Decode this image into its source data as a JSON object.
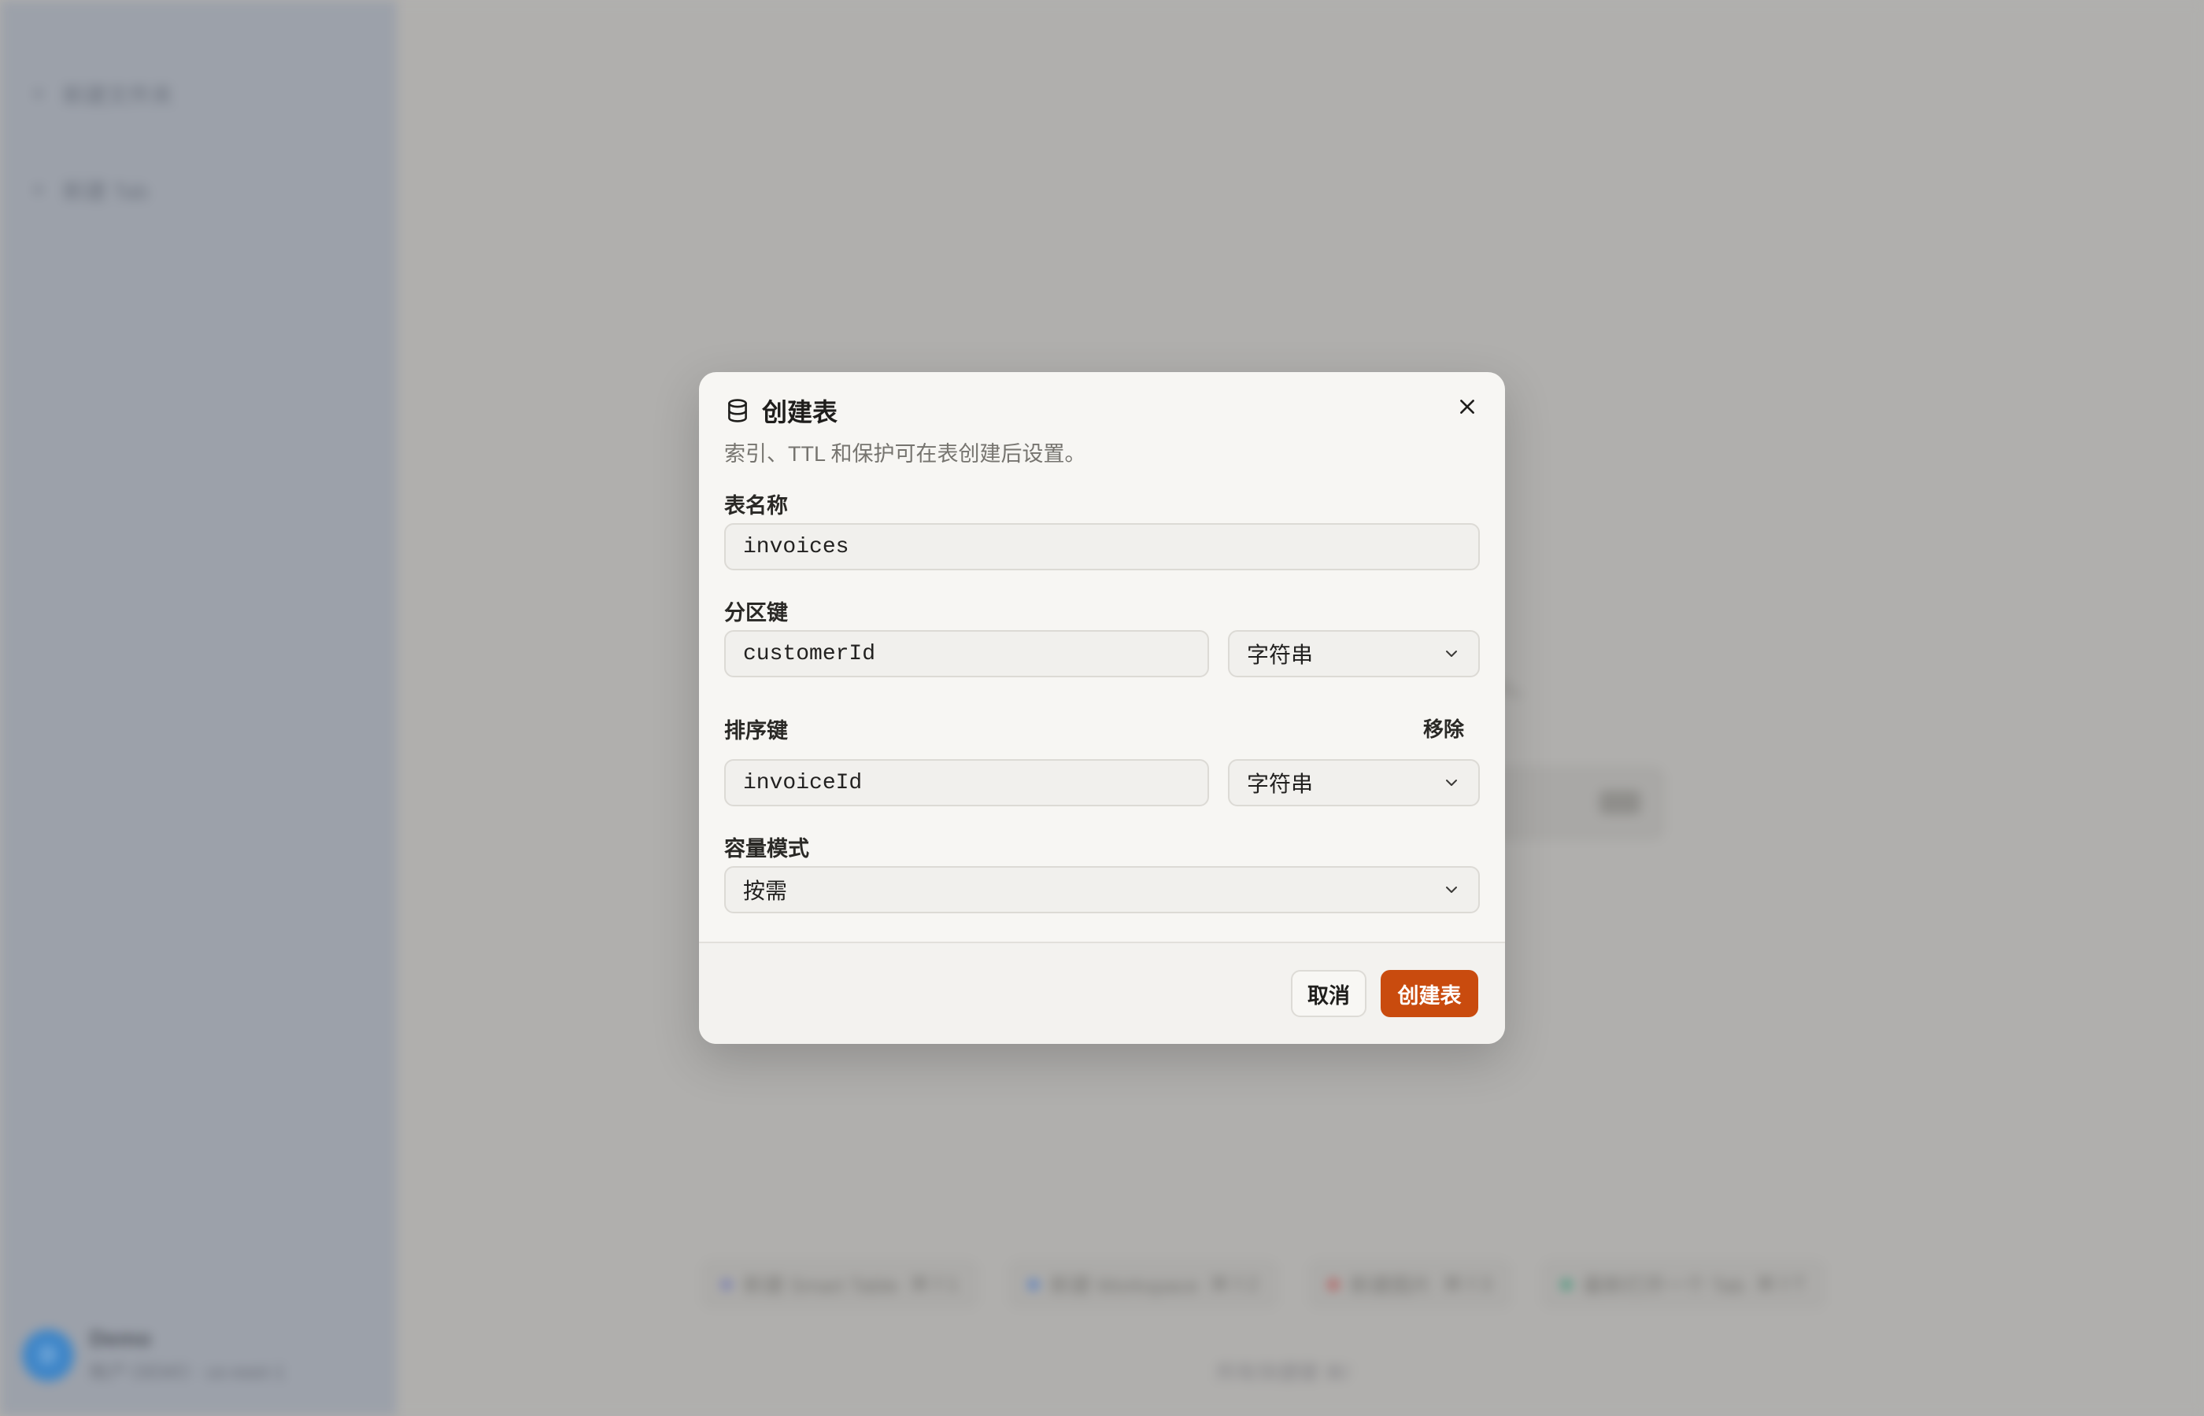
{
  "background": {
    "sidebar": {
      "items": [
        {
          "label": "新建文件夹"
        },
        {
          "label": "新建 Tab"
        }
      ],
      "user": {
        "avatar_initials": "D",
        "name": "Demo",
        "subtitle": "帐户 DEMO · us-east-1"
      }
    },
    "main": {
      "partial_text": "ch。",
      "card_badge": "新",
      "chips": [
        {
          "label": "新建 Smart Table",
          "shortcut": "⌘⇧1",
          "color": "#7a7fb0"
        },
        {
          "label": "新建 Workspace",
          "shortcut": "⌘⇧2",
          "color": "#5d82c0"
        },
        {
          "label": "新建图片",
          "shortcut": "⌘⇧3",
          "color": "#b46060"
        },
        {
          "label": "最新打开一个 Tab",
          "shortcut": "⌘⇧T",
          "color": "#4f9a80"
        }
      ],
      "footer_label": "所有快捷键",
      "footer_shortcut": "⌘/"
    }
  },
  "modal": {
    "title": "创建表",
    "description": "索引、TTL 和保护可在表创建后设置。",
    "table_name": {
      "label": "表名称",
      "value": "invoices"
    },
    "partition_key": {
      "label": "分区键",
      "value": "customerId",
      "type": "字符串"
    },
    "sort_key": {
      "label": "排序键",
      "value": "invoiceId",
      "type": "字符串",
      "remove_label": "移除"
    },
    "capacity_mode": {
      "label": "容量模式",
      "value": "按需"
    },
    "cancel_label": "取消",
    "create_label": "创建表"
  },
  "colors": {
    "accent": "#c94b0e",
    "modal_bg": "#f7f6f3",
    "overlay": "#b1b0ae"
  },
  "icons": {
    "title_icon": "database-icon",
    "close_icon": "close-icon",
    "select_icon": "chevron-down-icon"
  }
}
